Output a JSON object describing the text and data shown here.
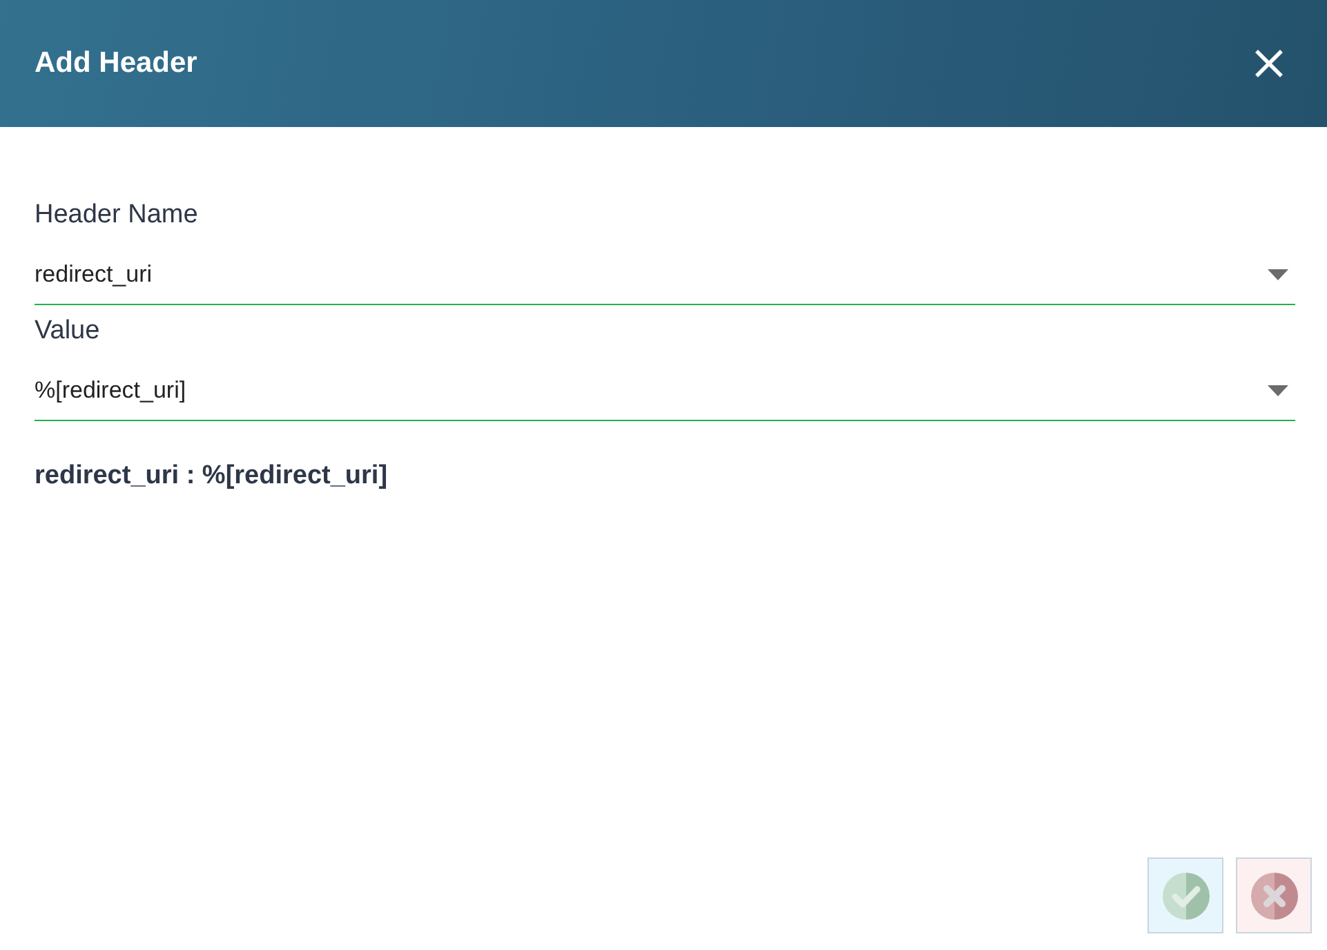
{
  "dialog": {
    "title": "Add Header"
  },
  "fields": [
    {
      "label": "Header Name",
      "value": "redirect_uri"
    },
    {
      "label": "Value",
      "value": "%[redirect_uri]"
    }
  ],
  "preview": "redirect_uri : %[redirect_uri]",
  "buttons": [
    {
      "kind": "confirm",
      "disabled": true
    },
    {
      "kind": "cancel",
      "disabled": true
    }
  ]
}
